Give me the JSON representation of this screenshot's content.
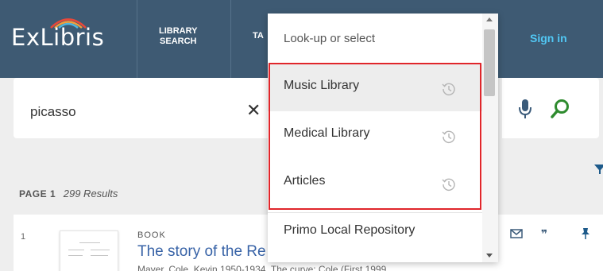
{
  "header": {
    "logo": "ExLibris",
    "nav": [
      {
        "line1": "LIBRARY",
        "line2": "SEARCH"
      },
      {
        "line1": "TA",
        "line2": ""
      }
    ],
    "sign_in": "Sign in"
  },
  "search": {
    "query": "picasso",
    "clear_icon": "close-icon",
    "mic_icon": "microphone-icon",
    "search_icon": "search-icon"
  },
  "dropdown": {
    "placeholder": "Look-up or select",
    "items": [
      {
        "label": "Music Library",
        "icon": "history-icon"
      },
      {
        "label": "Medical Library",
        "icon": "history-icon"
      },
      {
        "label": "Articles",
        "icon": "history-icon"
      },
      {
        "label": "Primo Local Repository",
        "icon": ""
      }
    ]
  },
  "results": {
    "page_label": "PAGE 1",
    "count_text": "299 Results",
    "items": [
      {
        "number": "1",
        "type": "BOOK",
        "title": "The story of the Re",
        "line": "Mayer, Cole, Kevin 1950-1934. The curve: Cole (First 1999"
      }
    ]
  },
  "colors": {
    "header_bg": "#3e5a73",
    "accent_blue": "#51c8f5",
    "title_blue": "#3863a7",
    "highlight_red": "#e0262b",
    "search_green": "#2e8b2e"
  }
}
